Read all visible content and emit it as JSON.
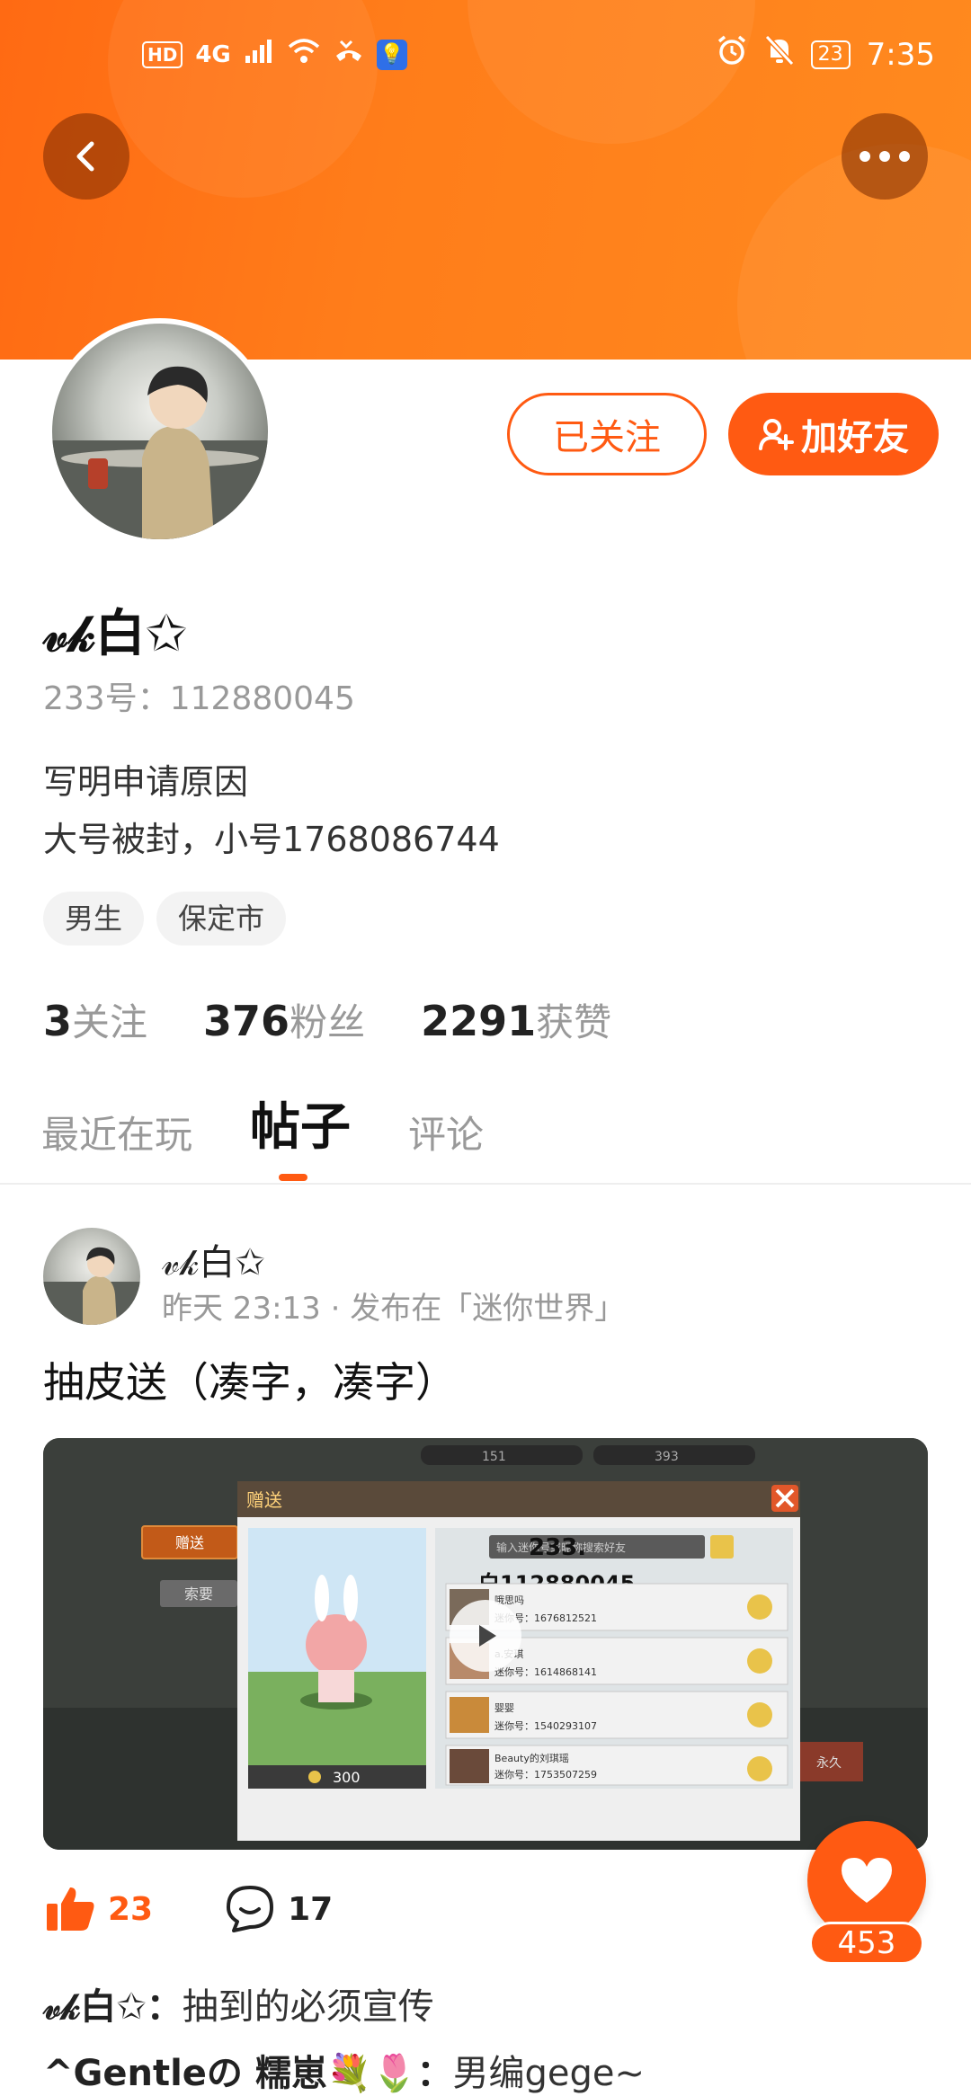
{
  "status_bar": {
    "left_badge": "HD",
    "network": "4G",
    "battery": "23",
    "time": "7:35"
  },
  "header": {
    "follow_label": "已关注",
    "add_friend_label": "加好友"
  },
  "profile": {
    "name": "𝓋𝓀白✩",
    "id_line": "233号：112880045",
    "bio_line1": "写明申请原因",
    "bio_line2": "大号被封，小号1768086744",
    "tags": [
      "男生",
      "保定市"
    ],
    "stats": {
      "following_count": "3",
      "following_label": "关注",
      "followers_count": "376",
      "followers_label": "粉丝",
      "likes_count": "2291",
      "likes_label": "获赞"
    }
  },
  "tabs": [
    "最近在玩",
    "帖子",
    "评论"
  ],
  "post": {
    "author": "𝓋𝓀白✩",
    "meta": "昨天 23:13 · 发布在「迷你世界」",
    "title": "抽皮送（凑字，凑字）",
    "media": {
      "dialog_title": "赠送",
      "side_btn_1": "赠送",
      "side_btn_2": "索要",
      "search_placeholder": "输入迷你号或昵称搜索好友",
      "overlay_line1": "233.",
      "overlay_line2": "白112880045",
      "coin_price": "300",
      "friends": [
        {
          "name": "哦思吗",
          "id": "迷你号：1676812521"
        },
        {
          "name": "a.安琪",
          "id": "迷你号：1614868141"
        },
        {
          "name": "婴婴",
          "id": "迷你号：1540293107"
        },
        {
          "name": "Beauty的刘琪瑶",
          "id": "迷你号：1753507259"
        }
      ],
      "top_bar_1": "151",
      "top_bar_2": "393",
      "side_right": "永久"
    },
    "like_count": "23",
    "comment_count": "17",
    "favorite_count": "453",
    "comments": [
      {
        "author": "𝓋𝓀白✩：",
        "text": "抽到的必须宣传"
      },
      {
        "author": "^Gentleの 糯崽💐🌷：",
        "text": "男编gege~"
      }
    ]
  },
  "colors": {
    "accent": "#ff5a12",
    "banner": "#ff7d1a"
  }
}
